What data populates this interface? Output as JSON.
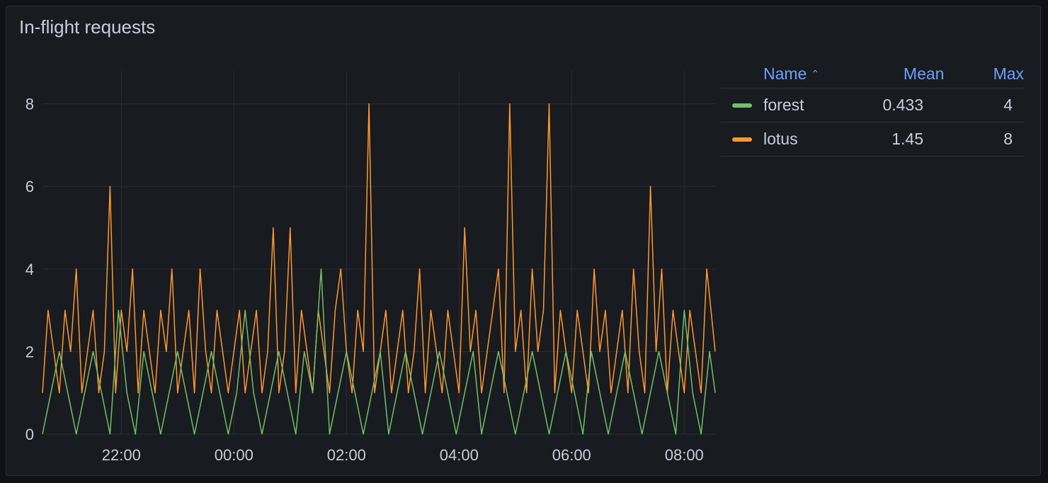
{
  "panel": {
    "title": "In-flight requests"
  },
  "legend": {
    "headers": {
      "name": "Name",
      "mean": "Mean",
      "max": "Max"
    },
    "rows": [
      {
        "name": "forest",
        "mean": "0.433",
        "max": "4",
        "color": "#73bf69"
      },
      {
        "name": "lotus",
        "mean": "1.45",
        "max": "8",
        "color": "#ff9830"
      }
    ]
  },
  "chart_data": {
    "type": "line",
    "title": "In-flight requests",
    "x_ticks": [
      "22:00",
      "00:00",
      "02:00",
      "04:00",
      "06:00",
      "08:00"
    ],
    "y_ticks": [
      0,
      2,
      4,
      6,
      8
    ],
    "ylim": [
      0,
      8.8
    ],
    "xlim_hours": [
      20.6,
      32.55
    ],
    "grid": true,
    "legend_placement": "right",
    "series": [
      {
        "name": "forest",
        "color": "#73bf69",
        "x": [
          20.6,
          20.75,
          20.9,
          21.05,
          21.2,
          21.35,
          21.5,
          21.65,
          21.8,
          21.95,
          22.1,
          22.25,
          22.4,
          22.55,
          22.7,
          22.85,
          23.0,
          23.15,
          23.3,
          23.45,
          23.6,
          23.75,
          23.9,
          24.05,
          24.2,
          24.35,
          24.5,
          24.65,
          24.8,
          24.95,
          25.1,
          25.25,
          25.4,
          25.55,
          25.7,
          25.85,
          26.0,
          26.15,
          26.3,
          26.45,
          26.6,
          26.75,
          26.9,
          27.05,
          27.2,
          27.35,
          27.5,
          27.65,
          27.8,
          27.95,
          28.1,
          28.25,
          28.4,
          28.55,
          28.7,
          28.85,
          29.0,
          29.15,
          29.3,
          29.45,
          29.6,
          29.75,
          29.9,
          30.05,
          30.2,
          30.35,
          30.5,
          30.65,
          30.8,
          30.95,
          31.1,
          31.25,
          31.4,
          31.55,
          31.7,
          31.85,
          32.0,
          32.15,
          32.3,
          32.45,
          32.55
        ],
        "values": [
          0,
          1,
          2,
          1,
          0,
          1,
          2,
          1,
          0,
          3,
          1,
          0,
          2,
          1,
          0,
          1,
          2,
          1,
          0,
          1,
          2,
          1,
          0,
          1,
          3,
          1,
          0,
          1,
          2,
          1,
          0,
          2,
          1,
          4,
          0,
          1,
          2,
          1,
          0,
          1,
          2,
          0,
          1,
          2,
          1,
          0,
          1,
          2,
          1,
          0,
          1,
          2,
          0,
          1,
          2,
          1,
          0,
          1,
          2,
          1,
          0,
          1,
          2,
          1,
          0,
          2,
          1,
          0,
          1,
          2,
          1,
          0,
          1,
          2,
          1,
          0,
          3,
          1,
          0,
          2,
          1
        ]
      },
      {
        "name": "lotus",
        "color": "#ff9830",
        "x": [
          20.6,
          20.7,
          20.8,
          20.9,
          21.0,
          21.1,
          21.2,
          21.3,
          21.4,
          21.5,
          21.6,
          21.7,
          21.8,
          21.9,
          22.0,
          22.1,
          22.2,
          22.3,
          22.4,
          22.5,
          22.6,
          22.7,
          22.8,
          22.9,
          23.0,
          23.1,
          23.2,
          23.3,
          23.4,
          23.5,
          23.6,
          23.7,
          23.8,
          23.9,
          24.0,
          24.1,
          24.2,
          24.3,
          24.4,
          24.5,
          24.6,
          24.7,
          24.8,
          24.9,
          25.0,
          25.1,
          25.2,
          25.3,
          25.4,
          25.5,
          25.6,
          25.7,
          25.8,
          25.9,
          26.0,
          26.1,
          26.2,
          26.3,
          26.4,
          26.5,
          26.6,
          26.7,
          26.8,
          26.9,
          27.0,
          27.1,
          27.2,
          27.3,
          27.4,
          27.5,
          27.6,
          27.7,
          27.8,
          27.9,
          28.0,
          28.1,
          28.2,
          28.3,
          28.4,
          28.5,
          28.6,
          28.7,
          28.8,
          28.9,
          29.0,
          29.1,
          29.2,
          29.3,
          29.4,
          29.5,
          29.6,
          29.7,
          29.8,
          29.9,
          30.0,
          30.1,
          30.2,
          30.3,
          30.4,
          30.5,
          30.6,
          30.7,
          30.8,
          30.9,
          31.0,
          31.1,
          31.2,
          31.3,
          31.4,
          31.5,
          31.6,
          31.7,
          31.8,
          31.9,
          32.0,
          32.1,
          32.2,
          32.3,
          32.4,
          32.55
        ],
        "values": [
          1,
          3,
          2,
          1,
          3,
          2,
          4,
          1,
          2,
          3,
          1,
          2,
          6,
          1,
          3,
          2,
          4,
          1,
          3,
          2,
          1,
          3,
          2,
          4,
          1,
          2,
          3,
          1,
          4,
          2,
          1,
          3,
          2,
          1,
          2,
          3,
          1,
          2,
          3,
          1,
          2,
          5,
          1,
          2,
          5,
          1,
          3,
          2,
          1,
          3,
          2,
          1,
          3,
          4,
          2,
          1,
          3,
          2,
          8,
          1,
          2,
          3,
          1,
          2,
          3,
          1,
          2,
          4,
          1,
          3,
          2,
          1,
          3,
          2,
          1,
          5,
          2,
          3,
          1,
          2,
          3,
          4,
          1,
          8,
          2,
          3,
          1,
          4,
          2,
          3,
          8,
          1,
          3,
          2,
          1,
          3,
          2,
          1,
          4,
          2,
          3,
          1,
          2,
          3,
          1,
          4,
          2,
          1,
          6,
          2,
          4,
          1,
          3,
          2,
          1,
          3,
          2,
          1,
          4,
          2
        ]
      }
    ]
  }
}
